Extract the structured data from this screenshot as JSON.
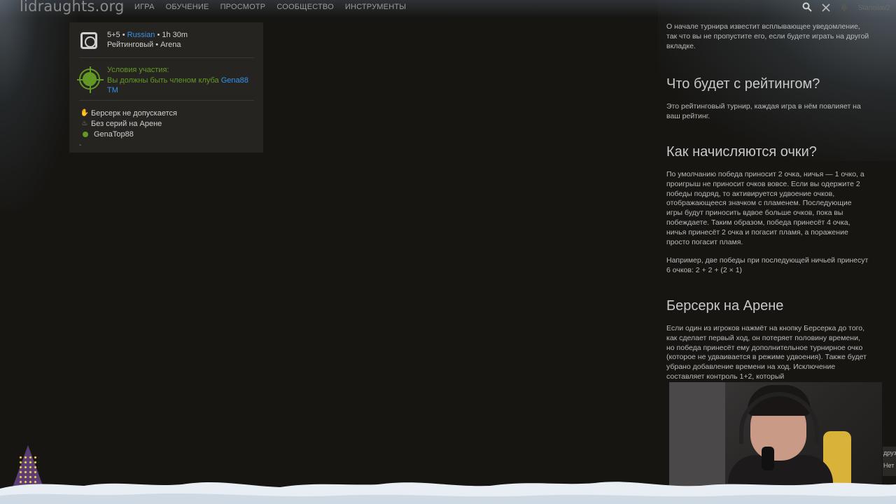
{
  "header": {
    "logo": "lidraughts.org",
    "nav": [
      "ИГРА",
      "ОБУЧЕНИЕ",
      "ПРОСМОТР",
      "СООБЩЕСТВО",
      "ИНСТРУМЕНТЫ"
    ],
    "username": "Stanislav2"
  },
  "tournament": {
    "clock": "5+5",
    "variant": "Russian",
    "duration": "1h 30m",
    "rated_type": "Рейтинговый • Arena",
    "conditions_title": "Условия участия:",
    "conditions_text": "Вы должны быть членом клуба",
    "club_name": "Gena88 TM",
    "rules": [
      "Берсерк не допускается",
      "Без серий на Арене"
    ],
    "creator": "GenaTop88",
    "dash": "-"
  },
  "info": {
    "intro": "О начале турнира известит всплывающее уведомление, так что вы не пропустите его, если будете играть на другой вкладке.",
    "rating_title": "Что будет с рейтингом?",
    "rating_text": "Это рейтинговый турнир, каждая игра в нём повлияет на ваш рейтинг.",
    "points_title": "Как начисляются очки?",
    "points_text": "По умолчанию победа приносит 2 очка, ничья — 1 очко, а проигрыш не приносит очков вовсе. Если вы одержите 2 победы подряд, то активируется удвоение очков, отображающееся значком с пламенем. Последующие игры будут приносить вдвое больше очков, пока вы побеждаете. Таким образом, победа принесёт 4 очка, ничья принесёт 2 очка и погасит пламя, а поражение просто погасит пламя.",
    "example_text": "Например, две победы при последующей ничьей принесут 6 очков: 2 + 2 + (2 × 1)",
    "berserk_title": "Берсерк на Арене",
    "berserk_text": "Если один из игроков нажмёт на кнопку Берсерка до того, как сделает первый ход, он потеряет половину времени, но победа принесёт ему дополнительное турнирное очко (которое не удваивается в режиме удвоения). Также будет убрано добавление времени на ход. Исключение составляет контроль 1+2, который"
  },
  "toast": {
    "line1": "друз",
    "line2": "Нет"
  }
}
